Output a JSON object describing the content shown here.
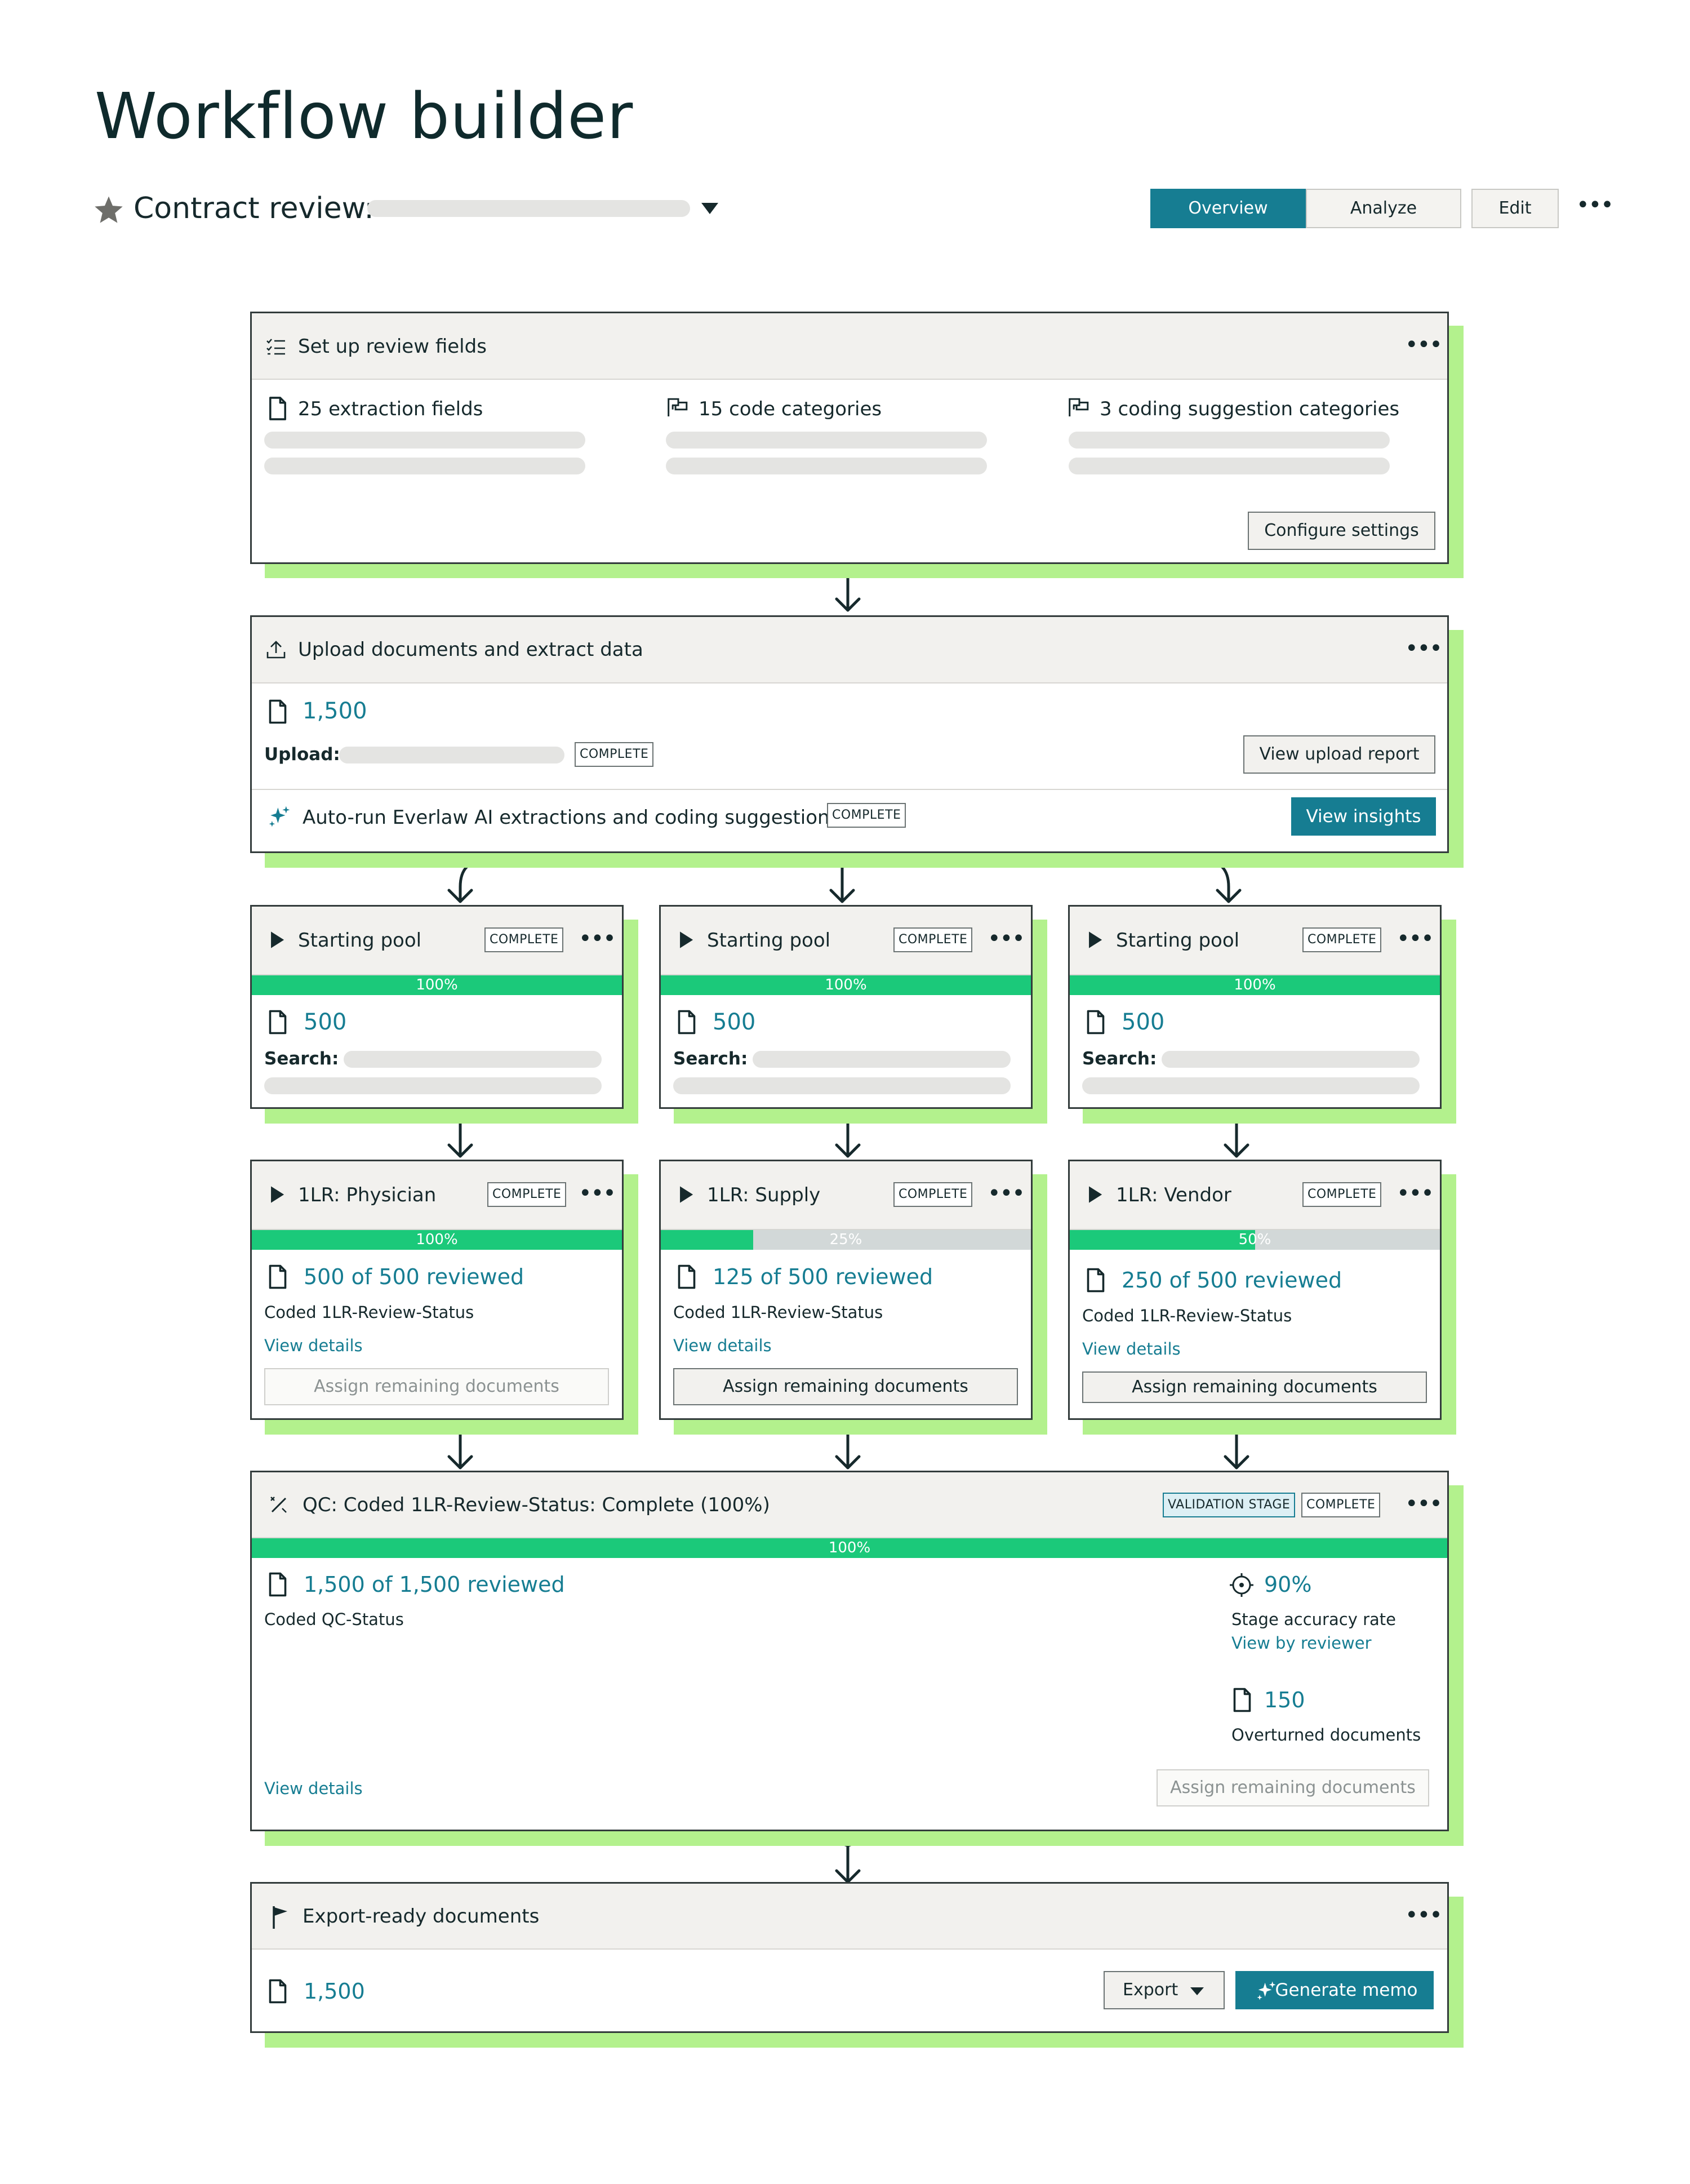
{
  "page_title": "Workflow builder",
  "contract": {
    "label": "Contract review:"
  },
  "tabs": {
    "overview": "Overview",
    "analyze": "Analyze",
    "edit": "Edit",
    "more": "•••"
  },
  "colors": {
    "accent": "#167d92",
    "progress": "#1bc97a",
    "card_shadow": "#b3f18d"
  },
  "setup": {
    "title": "Set up review fields",
    "more": "•••",
    "extraction": "25 extraction fields",
    "code": "15 code categories",
    "suggestion": "3 coding suggestion categories",
    "button": "Configure settings"
  },
  "upload": {
    "title": "Upload documents and extract data",
    "more": "•••",
    "count": "1,500",
    "upload_label": "Upload:",
    "upload_status": "COMPLETE",
    "report_button": "View upload report",
    "ai_label": "Auto-run Everlaw AI extractions and coding suggestions",
    "ai_status": "COMPLETE",
    "insights_button": "View insights"
  },
  "pools": [
    {
      "title": "Starting pool",
      "status": "COMPLETE",
      "more": "•••",
      "progress": 1.0,
      "pct": "100%",
      "count": "500",
      "search_label": "Search:"
    },
    {
      "title": "Starting pool",
      "status": "COMPLETE",
      "more": "•••",
      "progress": 1.0,
      "pct": "100%",
      "count": "500",
      "search_label": "Search:"
    },
    {
      "title": "Starting pool",
      "status": "COMPLETE",
      "more": "•••",
      "progress": 1.0,
      "pct": "100%",
      "count": "500",
      "search_label": "Search:"
    }
  ],
  "reviews": [
    {
      "title": "1LR: Physician",
      "status": "COMPLETE",
      "more": "•••",
      "progress": 1.0,
      "pct": "100%",
      "reviewed": "500 of 500 reviewed",
      "coded": "Coded 1LR-Review-Status",
      "details": "View details",
      "assign": "Assign remaining documents"
    },
    {
      "title": "1LR: Supply",
      "status": "COMPLETE",
      "more": "•••",
      "progress": 0.25,
      "pct": "25%",
      "reviewed": "125 of 500 reviewed",
      "coded": "Coded 1LR-Review-Status",
      "details": "View details",
      "assign": "Assign remaining documents"
    },
    {
      "title": "1LR: Vendor",
      "status": "COMPLETE",
      "more": "•••",
      "progress": 0.5,
      "pct": "50%",
      "reviewed": "250 of 500 reviewed",
      "coded": "Coded 1LR-Review-Status",
      "details": "View details",
      "assign": "Assign remaining documents"
    }
  ],
  "qc": {
    "title": "QC: Coded 1LR-Review-Status: Complete (100%)",
    "validation": "VALIDATION STAGE",
    "status": "COMPLETE",
    "more": "•••",
    "progress": 1.0,
    "pct": "100%",
    "reviewed": "1,500 of 1,500 reviewed",
    "coded": "Coded QC-Status",
    "accuracy": "90%",
    "accuracy_label": "Stage accuracy rate",
    "by_reviewer": "View by reviewer",
    "overturned": "150",
    "overturned_label": "Overturned documents",
    "details": "View details",
    "assign": "Assign remaining documents"
  },
  "export": {
    "title": "Export-ready documents",
    "more": "•••",
    "count": "1,500",
    "export_button": "Export",
    "memo_button": "Generate memo"
  }
}
